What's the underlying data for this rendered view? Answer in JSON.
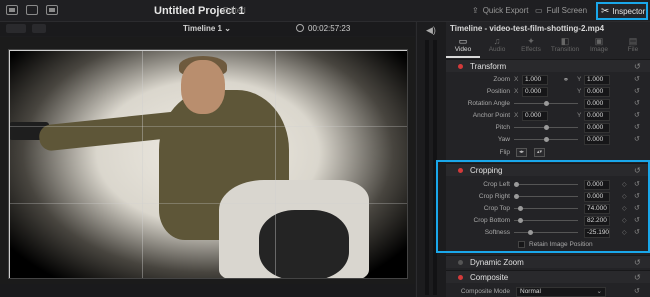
{
  "header": {
    "project_title": "Untitled Project 1",
    "edited_label": "Edited",
    "quick_export_label": "Quick Export",
    "full_screen_label": "Full Screen",
    "inspector_label": "Inspector"
  },
  "viewer": {
    "timeline_name": "Timeline 1",
    "timecode": "00:02:57:23"
  },
  "inspector": {
    "clip_title": "Timeline - video-test-film-shotting-2.mp4",
    "tabs": [
      {
        "label": "Video",
        "icon": "film-icon",
        "glyph": "▭"
      },
      {
        "label": "Audio",
        "icon": "music-icon",
        "glyph": "♫"
      },
      {
        "label": "Effects",
        "icon": "wand-icon",
        "glyph": "✦"
      },
      {
        "label": "Transition",
        "icon": "transition-icon",
        "glyph": "◧"
      },
      {
        "label": "Image",
        "icon": "image-icon",
        "glyph": "▣"
      },
      {
        "label": "File",
        "icon": "file-icon",
        "glyph": "▤"
      }
    ],
    "transform": {
      "label": "Transform",
      "zoom": {
        "label": "Zoom",
        "x_axis": "X",
        "x": "1.000",
        "y_axis": "Y",
        "y": "1.000"
      },
      "position": {
        "label": "Position",
        "x_axis": "X",
        "x": "0.000",
        "y_axis": "Y",
        "y": "0.000"
      },
      "rotation": {
        "label": "Rotation Angle",
        "value": "0.000"
      },
      "anchor": {
        "label": "Anchor Point",
        "x_axis": "X",
        "x": "0.000",
        "y_axis": "Y",
        "y": "0.000"
      },
      "pitch": {
        "label": "Pitch",
        "value": "0.000"
      },
      "yaw": {
        "label": "Yaw",
        "value": "0.000"
      },
      "flip": {
        "label": "Flip"
      }
    },
    "cropping": {
      "label": "Cropping",
      "crop_left": {
        "label": "Crop Left",
        "value": "0.000"
      },
      "crop_right": {
        "label": "Crop Right",
        "value": "0.000"
      },
      "crop_top": {
        "label": "Crop Top",
        "value": "74.000"
      },
      "crop_bottom": {
        "label": "Crop Bottom",
        "value": "82.200"
      },
      "softness": {
        "label": "Softness",
        "value": "-25.190"
      },
      "retain_label": "Retain Image Position"
    },
    "dynamic_zoom": {
      "label": "Dynamic Zoom"
    },
    "composite": {
      "label": "Composite",
      "mode_label": "Composite Mode",
      "mode_value": "Normal"
    }
  },
  "colors": {
    "accent": "#1aa7ea",
    "enabled_dot": "#d43a3a"
  }
}
